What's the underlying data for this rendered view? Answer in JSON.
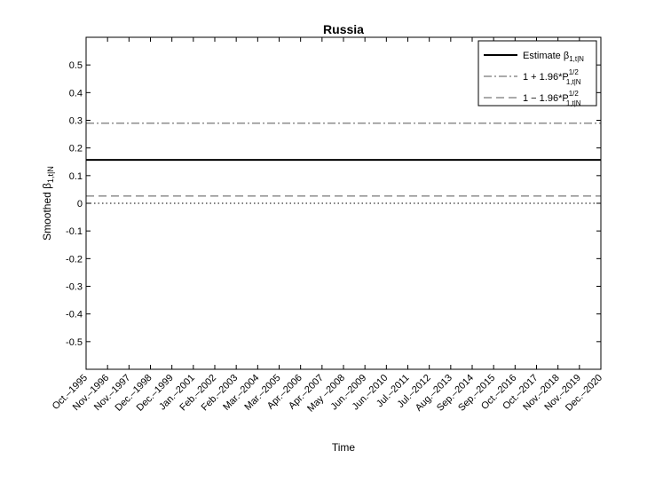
{
  "chart_data": {
    "type": "line",
    "title": "Russia",
    "xlabel": "Time",
    "ylabel": {
      "main": "Smoothed β",
      "sub": "1,t|N"
    },
    "ylim": [
      -0.6,
      0.6
    ],
    "yticks": [
      0.5,
      0.4,
      0.3,
      0.2,
      0.1,
      0,
      -0.1,
      -0.2,
      -0.3,
      -0.4,
      -0.5
    ],
    "ytick_labels": [
      "0.5",
      "0.4",
      "0.3",
      "0.2",
      "0.1",
      "0",
      "-0.1",
      "-0.2",
      "-0.3",
      "-0.4",
      "-0.5"
    ],
    "x_categories": [
      "Oct.–1995",
      "Nov.–1996",
      "Nov.–1997",
      "Dec.–1998",
      "Dec.–1999",
      "Jan.–2001",
      "Feb.–2002",
      "Feb.–2003",
      "Mar.–2004",
      "Mar.–2005",
      "Apr.–2006",
      "Apr.–2007",
      "May –2008",
      "Jun.–2009",
      "Jun.–2010",
      "Jul.–2011",
      "Jul.–2012",
      "Aug.–2013",
      "Sep.–2014",
      "Sep.–2015",
      "Oct.–2016",
      "Oct.–2017",
      "Nov.–2018",
      "Nov.–2019",
      "Dec.–2020"
    ],
    "grid": false,
    "legend_position": "top-right",
    "series": [
      {
        "key": "estimate",
        "value": 0.157,
        "style": "solid",
        "color": "#000000",
        "legend_main": "Estimate β",
        "legend_sub": "1,t|N",
        "legend_sup": ""
      },
      {
        "key": "upper",
        "value": 0.289,
        "style": "dashdot",
        "color": "#555555",
        "legend_main": "1 + 1.96*P",
        "legend_sub": "1,t|N",
        "legend_sup": "1/2"
      },
      {
        "key": "lower",
        "value": 0.026,
        "style": "dashed",
        "color": "#555555",
        "legend_main": "1 − 1.96*P",
        "legend_sub": "1,t|N",
        "legend_sup": "1/2"
      }
    ],
    "reference_line": {
      "value": 0,
      "style": "dotted",
      "color": "#000000"
    }
  }
}
